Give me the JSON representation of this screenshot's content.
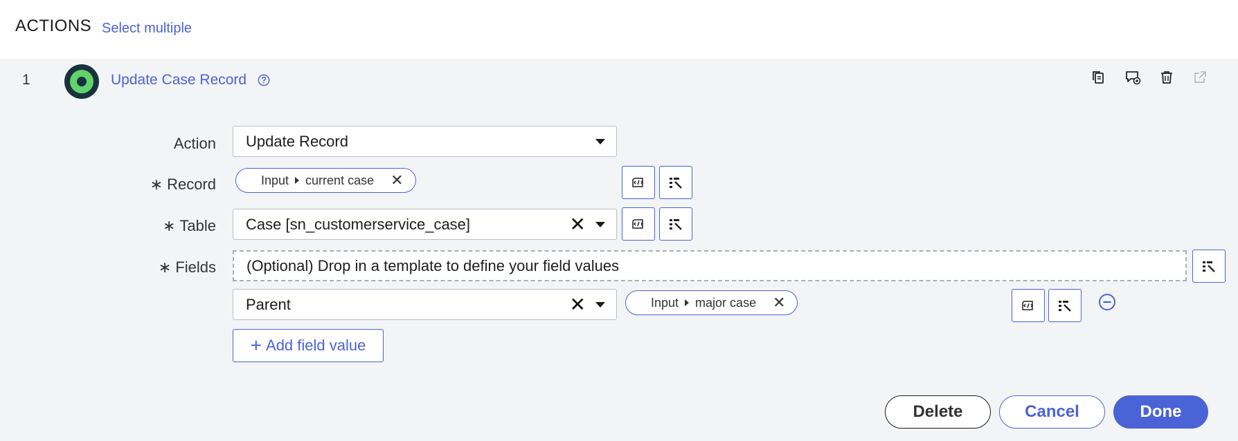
{
  "header": {
    "title": "ACTIONS",
    "select_multiple": "Select multiple"
  },
  "step": {
    "number": "1",
    "title": "Update Case Record",
    "toolbar_icons": [
      "copy-icon",
      "add-comment-icon",
      "trash-icon",
      "open-external-icon"
    ]
  },
  "form": {
    "action": {
      "label": "Action",
      "value": "Update Record"
    },
    "record": {
      "label": "Record",
      "required": "∗",
      "pill": {
        "source": "Input",
        "value": "current case"
      }
    },
    "table": {
      "label": "Table",
      "required": "∗",
      "value": "Case [sn_customerservice_case]"
    },
    "fields": {
      "label": "Fields",
      "required": "∗",
      "dropzone_text": "(Optional) Drop in a template to define your field values",
      "rows": [
        {
          "field": "Parent",
          "pill": {
            "source": "Input",
            "value": "major case"
          }
        }
      ],
      "add_label": "Add field value"
    }
  },
  "footer": {
    "delete": "Delete",
    "cancel": "Cancel",
    "done": "Done"
  },
  "colors": {
    "accent": "#4a63d6",
    "panel_bg": "#f3f4f6",
    "avatar_green": "#62d36a",
    "avatar_dark": "#18333c"
  }
}
